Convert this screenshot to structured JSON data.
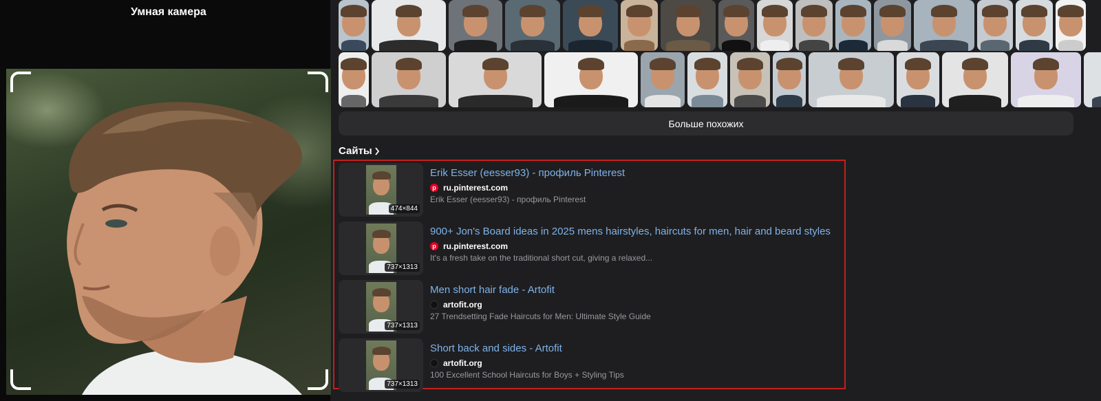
{
  "camera": {
    "title": "Умная камера"
  },
  "similar": {
    "row1": [
      {
        "w": 44,
        "bg": "#b9c4cc",
        "shirt": "#3a4a5c"
      },
      {
        "w": 108,
        "bg": "#e6e8ea",
        "shirt": "#2c2c2c"
      },
      {
        "w": 78,
        "bg": "#6d7378",
        "shirt": "#1f1f22"
      },
      {
        "w": 80,
        "bg": "#5a6a72",
        "shirt": "#2a3139"
      },
      {
        "w": 80,
        "bg": "#3b4a57",
        "shirt": "#1b2530"
      },
      {
        "w": 54,
        "bg": "#c9b39a",
        "shirt": "#8a6a4a"
      },
      {
        "w": 80,
        "bg": "#4d4a46",
        "shirt": "#6b5a46"
      },
      {
        "w": 52,
        "bg": "#5a5a5a",
        "shirt": "#111111"
      },
      {
        "w": 52,
        "bg": "#d7d7d7",
        "shirt": "#eeeeee"
      },
      {
        "w": 54,
        "bg": "#bfbfbf",
        "shirt": "#444444"
      },
      {
        "w": 52,
        "bg": "#aab6bf",
        "shirt": "#1c2a38"
      },
      {
        "w": 54,
        "bg": "#8e97a0",
        "shirt": "#d9d9d9"
      },
      {
        "w": 88,
        "bg": "#a7b3bd",
        "shirt": "#3b4652"
      },
      {
        "w": 52,
        "bg": "#c5cbd0",
        "shirt": "#5a6670"
      },
      {
        "w": 54,
        "bg": "#d6dbe0",
        "shirt": "#2f3a45"
      },
      {
        "w": 44,
        "bg": "#f2f2f2",
        "shirt": "#cccccc"
      }
    ],
    "row2": [
      {
        "w": 44,
        "bg": "#eeeeee",
        "shirt": "#666666"
      },
      {
        "w": 108,
        "bg": "#cfcfcf",
        "shirt": "#3a3a3a"
      },
      {
        "w": 135,
        "bg": "#d9d9d9",
        "shirt": "#2a2a2a"
      },
      {
        "w": 136,
        "bg": "#f0f0f0",
        "shirt": "#1a1a1a"
      },
      {
        "w": 64,
        "bg": "#9aa5ad",
        "shirt": "#e3e3e3"
      },
      {
        "w": 58,
        "bg": "#d8dde0",
        "shirt": "#7a8a96"
      },
      {
        "w": 58,
        "bg": "#c7c1b8",
        "shirt": "#4a4a4a"
      },
      {
        "w": 48,
        "bg": "#c4ccd2",
        "shirt": "#2d3a47"
      },
      {
        "w": 124,
        "bg": "#c8cdd1",
        "shirt": "#e9e9e9"
      },
      {
        "w": 62,
        "bg": "#d9dde0",
        "shirt": "#2a3440"
      },
      {
        "w": 96,
        "bg": "#e4e4e4",
        "shirt": "#1f1f1f"
      },
      {
        "w": 102,
        "bg": "#d8d4e6",
        "shirt": "#eeeeee"
      },
      {
        "w": 124,
        "bg": "#dde1e4",
        "shirt": "#3a4450"
      }
    ],
    "more_label": "Больше похожих"
  },
  "sites": {
    "heading": "Сайты",
    "results": [
      {
        "title": "Erik Esser (eesser93) - профиль Pinterest",
        "site": "ru.pinterest.com",
        "favicon": "pinterest-icon",
        "description": "Erik Esser (eesser93) - профиль Pinterest",
        "dims": "474×844"
      },
      {
        "title": "900+ Jon's Board ideas in 2025 mens hairstyles, haircuts for men, hair and beard styles",
        "site": "ru.pinterest.com",
        "favicon": "pinterest-icon",
        "description": "It's a fresh take on the traditional short cut, giving a relaxed...",
        "dims": "737×1313"
      },
      {
        "title": "Men short hair fade - Artofit",
        "site": "artofit.org",
        "favicon": "artofit-icon",
        "description": "27 Trendsetting Fade Haircuts for Men: Ultimate Style Guide",
        "dims": "737×1313"
      },
      {
        "title": "Short back and sides - Artofit",
        "site": "artofit.org",
        "favicon": "artofit-icon",
        "description": "100 Excellent School Haircuts for Boys + Styling Tips",
        "dims": "737×1313"
      }
    ]
  }
}
